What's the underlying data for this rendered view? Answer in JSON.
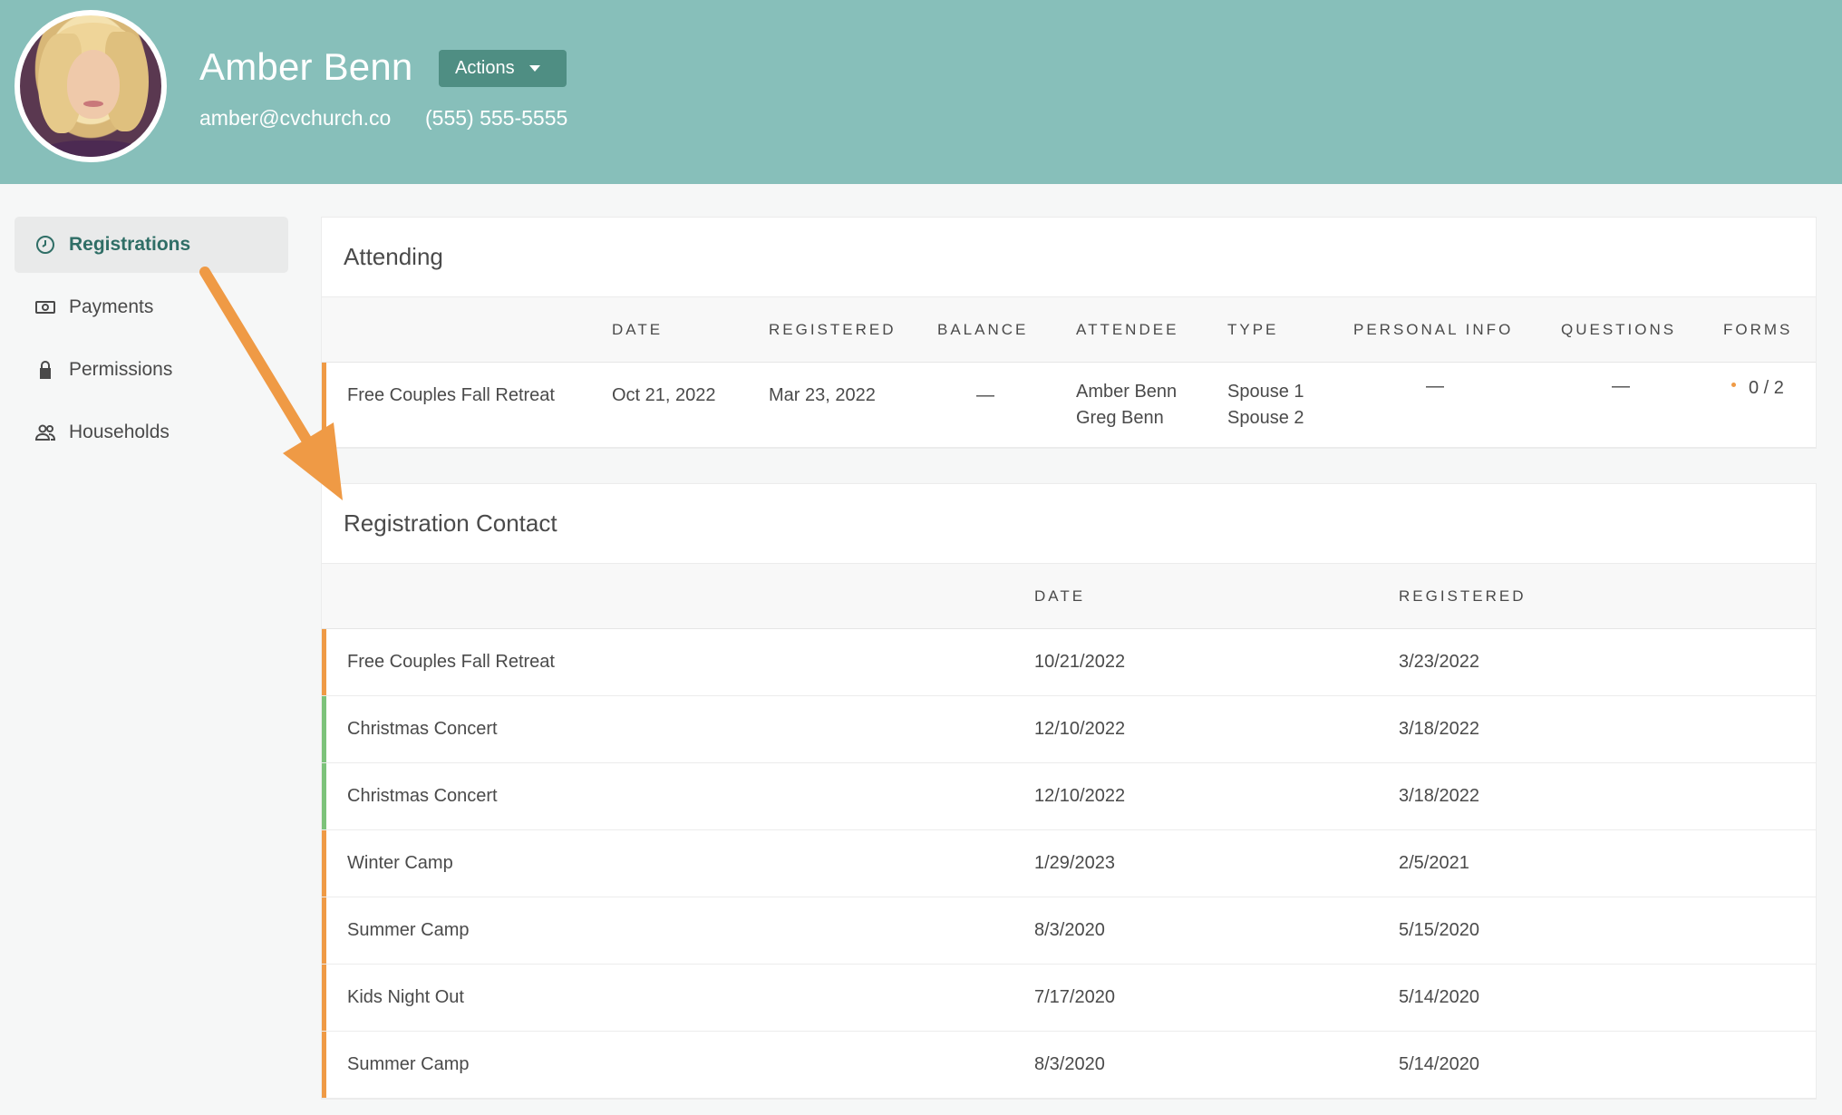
{
  "header": {
    "name": "Amber Benn",
    "actions_label": "Actions",
    "email": "amber@cvchurch.co",
    "phone": "(555) 555-5555"
  },
  "sidebar": {
    "items": [
      {
        "label": "Registrations",
        "icon": "clock-icon",
        "active": true
      },
      {
        "label": "Payments",
        "icon": "money-icon",
        "active": false
      },
      {
        "label": "Permissions",
        "icon": "lock-icon",
        "active": false
      },
      {
        "label": "Households",
        "icon": "users-icon",
        "active": false
      }
    ]
  },
  "attending": {
    "title": "Attending",
    "columns": [
      "DATE",
      "REGISTERED",
      "BALANCE",
      "ATTENDEE",
      "TYPE",
      "PERSONAL INFO",
      "QUESTIONS",
      "FORMS"
    ],
    "rows": [
      {
        "name": "Free Couples Fall Retreat",
        "date": "Oct 21, 2022",
        "registered": "Mar 23, 2022",
        "balance": "—",
        "attendee_1": "Amber Benn",
        "attendee_2": "Greg Benn",
        "type_1": "Spouse 1",
        "type_2": "Spouse 2",
        "personal_info": "—",
        "questions": "—",
        "forms": "0 / 2",
        "accent": "#ef9a45"
      }
    ]
  },
  "registration_contact": {
    "title": "Registration Contact",
    "columns": [
      "DATE",
      "REGISTERED"
    ],
    "rows": [
      {
        "name": "Free Couples Fall Retreat",
        "date": "10/21/2022",
        "registered": "3/23/2022",
        "accent": "#ef9a45"
      },
      {
        "name": "Christmas Concert",
        "date": "12/10/2022",
        "registered": "3/18/2022",
        "accent": "#7cc27a"
      },
      {
        "name": "Christmas Concert",
        "date": "12/10/2022",
        "registered": "3/18/2022",
        "accent": "#7cc27a"
      },
      {
        "name": "Winter Camp",
        "date": "1/29/2023",
        "registered": "2/5/2021",
        "accent": "#ef9a45"
      },
      {
        "name": "Summer Camp",
        "date": "8/3/2020",
        "registered": "5/15/2020",
        "accent": "#ef9a45"
      },
      {
        "name": "Kids Night Out",
        "date": "7/17/2020",
        "registered": "5/14/2020",
        "accent": "#ef9a45"
      },
      {
        "name": "Summer Camp",
        "date": "8/3/2020",
        "registered": "5/14/2020",
        "accent": "#ef9a45"
      }
    ]
  },
  "colors": {
    "header_bg": "#87bfba",
    "actions_bg": "#4f8e83",
    "active_nav": "#2f6e66",
    "arrow": "#ef9a45"
  }
}
